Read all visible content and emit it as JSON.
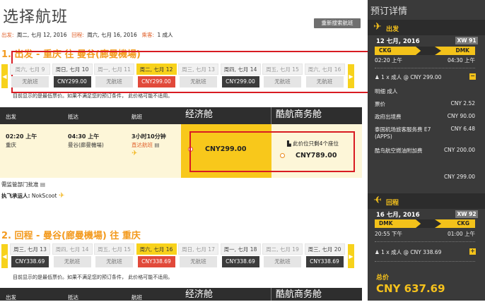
{
  "page": {
    "title": "选择航班",
    "new_search": "重新搜索航班",
    "summary": {
      "depart_label": "出发:",
      "depart_value": "周二, 七月 12, 2016",
      "return_label": "回程:",
      "return_value": "周六, 七月 16, 2016",
      "pax_label": "乘客:",
      "pax_value": "1 成人"
    }
  },
  "outbound": {
    "title": "1. 出发 - 重庆 往 曼谷(廊曼機場)",
    "days": [
      {
        "label": "周六, 七月 9",
        "price": "无航班",
        "state": "none"
      },
      {
        "label": "周日, 七月 10",
        "price": "CNY299.00",
        "state": "avail"
      },
      {
        "label": "周一, 七月 11",
        "price": "无航班",
        "state": "none"
      },
      {
        "label": "周二, 七月 12",
        "price": "CNY299.00",
        "state": "sel"
      },
      {
        "label": "周三, 七月 13",
        "price": "无航班",
        "state": "none"
      },
      {
        "label": "周四, 七月 14",
        "price": "CNY299.00",
        "state": "avail"
      },
      {
        "label": "周五, 七月 15",
        "price": "无航班",
        "state": "none"
      },
      {
        "label": "周六, 七月 16",
        "price": "无航班",
        "state": "none"
      }
    ],
    "note": "目前显示的是最低票价。如果不满足您的预订条件， 此价格可能不适用。",
    "headers": {
      "depart": "出发",
      "arrive": "抵达",
      "flight": "航班",
      "eco": "经济舱",
      "biz": "酷航商务舱"
    },
    "flight": {
      "dep_time": "02:20 上午",
      "dep_city": "重庆",
      "arr_time": "04:30 上午",
      "arr_city": "曼谷(廊曼機場)",
      "duration": "3小时10分钟",
      "detail_link": "直达航班",
      "eco_price": "CNY299.00",
      "biz_note": "此价位只剩4个座位",
      "biz_price": "CNY789.00"
    },
    "approval": "需监管部门批准",
    "operator_label": "执飞承运人:",
    "operator": "NokScoot"
  },
  "inbound": {
    "title": "2. 回程 - 曼谷(廊曼機場) 往 重庆",
    "days": [
      {
        "label": "周三, 七月 13",
        "price": "CNY338.69",
        "state": "avail"
      },
      {
        "label": "周四, 七月 14",
        "price": "无航班",
        "state": "none"
      },
      {
        "label": "周五, 七月 15",
        "price": "无航班",
        "state": "none"
      },
      {
        "label": "周六, 七月 16",
        "price": "CNY338.69",
        "state": "sel"
      },
      {
        "label": "周日, 七月 17",
        "price": "无航班",
        "state": "none"
      },
      {
        "label": "周一, 七月 18",
        "price": "CNY338.69",
        "state": "avail"
      },
      {
        "label": "周二, 七月 19",
        "price": "无航班",
        "state": "none"
      },
      {
        "label": "周三, 七月 20",
        "price": "CNY338.69",
        "state": "avail"
      }
    ],
    "note": "目前显示的是最低票价。如果不满足您的预订条件， 此价格可能不适用。",
    "headers": {
      "depart": "出发",
      "arrive": "抵达",
      "flight": "航班",
      "eco": "经济舱",
      "biz": "酷航商务舱"
    }
  },
  "sidebar": {
    "title": "预订详情",
    "out": {
      "label": "出发",
      "date": "12 七月, 2016",
      "flight_no": "XW 91",
      "from": "CKG",
      "to": "DMK",
      "dep": "02:20 上午",
      "arr": "04:30 上午",
      "pax": "1 x 成人 @ CNY 299.00",
      "lines": [
        {
          "k": "明细 成人",
          "v": ""
        },
        {
          "k": "票价",
          "v": "CNY 2.52"
        },
        {
          "k": "政府出境费",
          "v": "CNY 90.00"
        },
        {
          "k": "泰国机场旅客服务费 E7 (APPS)",
          "v": "CNY 6.48"
        },
        {
          "k": "酷鸟航空燃油附加费",
          "v": "CNY 200.00"
        },
        {
          "k": "",
          "v": "CNY 299.00"
        }
      ]
    },
    "ret": {
      "label": "回程",
      "date": "16 七月, 2016",
      "flight_no": "XW 92",
      "from": "DMK",
      "to": "CKG",
      "dep": "20:55 下午",
      "arr": "01:00 上午",
      "pax": "1 x 成人 @ CNY 338.69"
    },
    "total_label": "总价",
    "total": "CNY 637.69"
  },
  "colors": {
    "accent": "#f39a1e",
    "selected": "#e1493a",
    "yellow": "#f8c81b",
    "highlight": "#d81b22"
  }
}
